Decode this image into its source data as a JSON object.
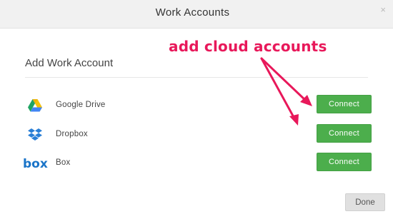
{
  "dialog": {
    "title": "Work Accounts",
    "close_glyph": "×",
    "section_title": "Add Work Account",
    "done_label": "Done"
  },
  "accounts": [
    {
      "name": "Google Drive",
      "icon": "google-drive-icon",
      "button_label": "Connect"
    },
    {
      "name": "Dropbox",
      "icon": "dropbox-icon",
      "button_label": "Connect"
    },
    {
      "name": "Box",
      "icon": "box-icon",
      "button_label": "Connect"
    }
  ],
  "annotation": {
    "text": "add cloud accounts",
    "color": "#e8185a"
  },
  "colors": {
    "connect_button": "#4cae4c",
    "header_bg": "#f1f1f1",
    "done_button": "#e0e0e0",
    "dropbox_blue": "#2a7fd6",
    "box_blue": "#1a74c8"
  }
}
